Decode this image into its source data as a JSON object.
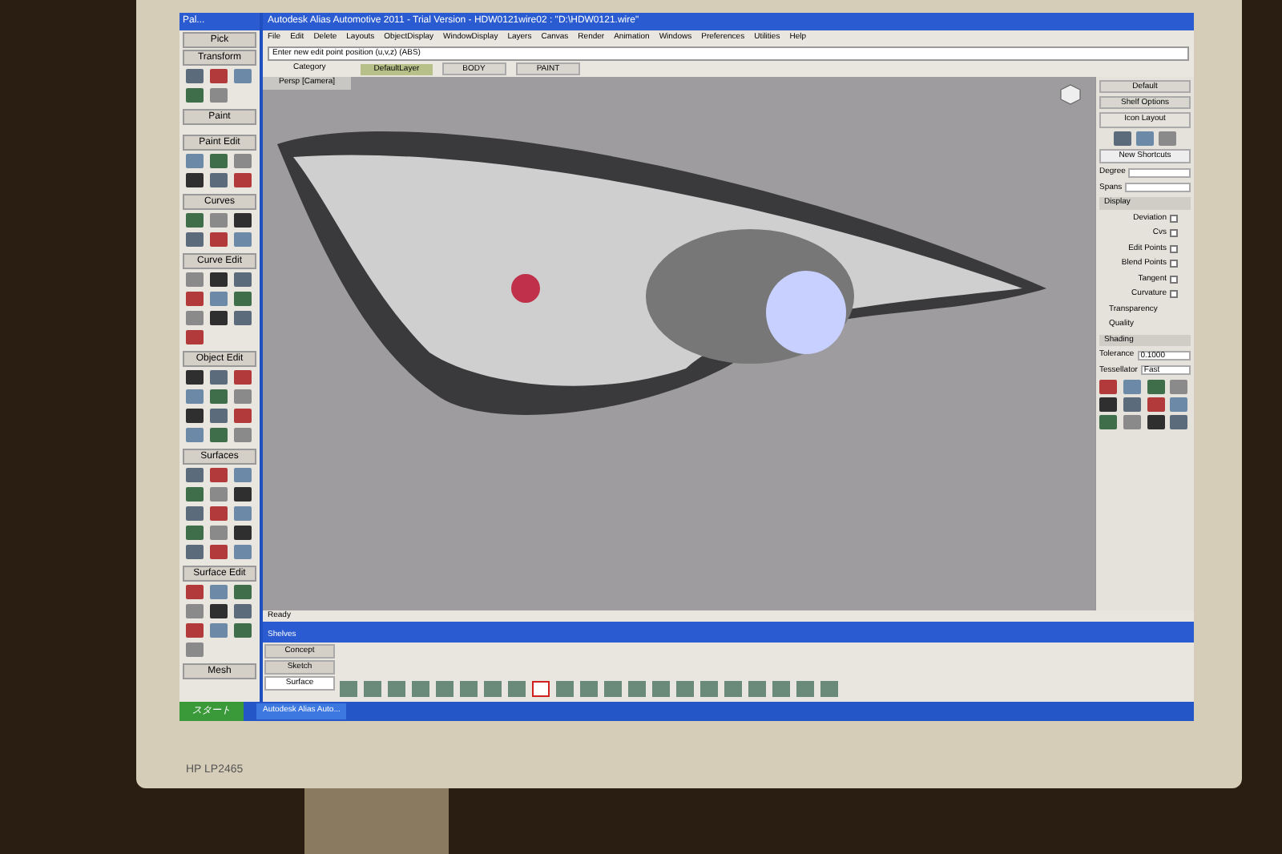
{
  "monitor": {
    "brand": "HP LP2465"
  },
  "palette": {
    "title": "Pal...",
    "pick": "Pick",
    "sections": [
      {
        "label": "Transform"
      },
      {
        "label": "Paint"
      },
      {
        "label": "Paint Edit"
      },
      {
        "label": "Curves"
      },
      {
        "label": "Curve Edit"
      },
      {
        "label": "Object Edit"
      },
      {
        "label": "Surfaces"
      },
      {
        "label": "Surface Edit"
      },
      {
        "label": "Mesh"
      }
    ]
  },
  "window": {
    "title": "Autodesk Alias Automotive 2011 - Trial Version - HDW0121wire02 : \"D:\\HDW0121.wire\"",
    "menu": [
      "File",
      "Edit",
      "Delete",
      "Layouts",
      "ObjectDisplay",
      "WindowDisplay",
      "Layers",
      "Canvas",
      "Render",
      "Animation",
      "Windows",
      "Preferences",
      "Utilities",
      "Help"
    ],
    "prompt": "Enter new edit point position (u,v,z) (ABS)",
    "category_label": "Category",
    "layer": "DefaultLayer",
    "fields": [
      "BODY",
      "PAINT"
    ],
    "viewport_label": "Persp [Camera]",
    "status": "Ready"
  },
  "shelf_panel": {
    "options": [
      "Default",
      "Shelf Options"
    ],
    "header": "Icon Layout",
    "shortcuts": "New Shortcuts"
  },
  "control_panel": {
    "rows": [
      {
        "kind": "field",
        "label": "Degree"
      },
      {
        "kind": "field",
        "label": "Spans"
      },
      {
        "kind": "section",
        "label": "Display"
      },
      {
        "kind": "check",
        "label": "Deviation",
        "checked": false
      },
      {
        "kind": "check",
        "label": "Cvs",
        "checked": false
      },
      {
        "kind": "check",
        "label": "Edit Points",
        "checked": false
      },
      {
        "kind": "check",
        "label": "Blend Points",
        "checked": false
      },
      {
        "kind": "check",
        "label": "Tangent",
        "checked": false
      },
      {
        "kind": "check",
        "label": "Curvature",
        "checked": false
      },
      {
        "kind": "item",
        "label": "Transparency"
      },
      {
        "kind": "item",
        "label": "Quality"
      },
      {
        "kind": "section",
        "label": "Shading"
      },
      {
        "kind": "field",
        "label": "Tolerance",
        "value": "0.1000"
      },
      {
        "kind": "field",
        "label": "Tessellator",
        "value": "Fast"
      }
    ]
  },
  "shelves": {
    "title": "Shelves",
    "tabs": [
      {
        "label": "Concept",
        "selected": false
      },
      {
        "label": "Sketch",
        "selected": false
      },
      {
        "label": "Surface",
        "selected": true
      }
    ],
    "tools": [
      {
        "selected": false
      },
      {
        "selected": false
      },
      {
        "selected": false
      },
      {
        "selected": false
      },
      {
        "selected": false
      },
      {
        "selected": false
      },
      {
        "selected": false
      },
      {
        "selected": false
      },
      {
        "selected": true
      },
      {
        "selected": false
      },
      {
        "selected": false
      },
      {
        "selected": false
      },
      {
        "selected": false
      },
      {
        "selected": false
      },
      {
        "selected": false
      },
      {
        "selected": false
      },
      {
        "selected": false
      },
      {
        "selected": false
      },
      {
        "selected": false
      },
      {
        "selected": false
      },
      {
        "selected": false
      }
    ]
  },
  "taskbar": {
    "start": "スタート",
    "task": "Autodesk Alias Auto..."
  }
}
